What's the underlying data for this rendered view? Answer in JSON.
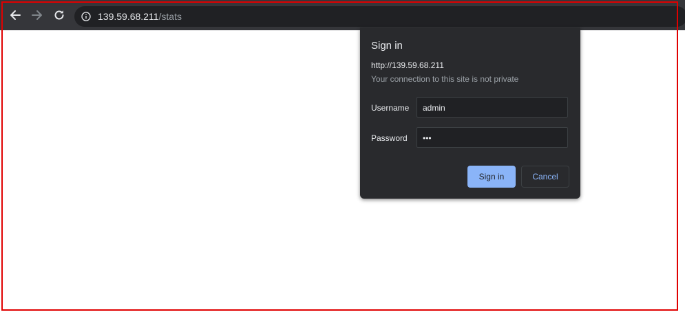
{
  "browser": {
    "url_host": "139.59.68.211",
    "url_path": "/stats",
    "icons": {
      "back": "back-arrow-icon",
      "forward": "forward-arrow-icon",
      "reload": "reload-icon",
      "site_info": "info-icon"
    }
  },
  "auth_dialog": {
    "title": "Sign in",
    "origin": "http://139.59.68.211",
    "privacy_note": "Your connection to this site is not private",
    "username_label": "Username",
    "username_value": "admin",
    "password_label": "Password",
    "password_value": "•••",
    "sign_in_label": "Sign in",
    "cancel_label": "Cancel"
  },
  "colors": {
    "toolbar": "#35363a",
    "omnibox": "#202124",
    "dialog": "#292a2d",
    "accent": "#8ab4f8",
    "highlight_frame": "#e00000"
  }
}
